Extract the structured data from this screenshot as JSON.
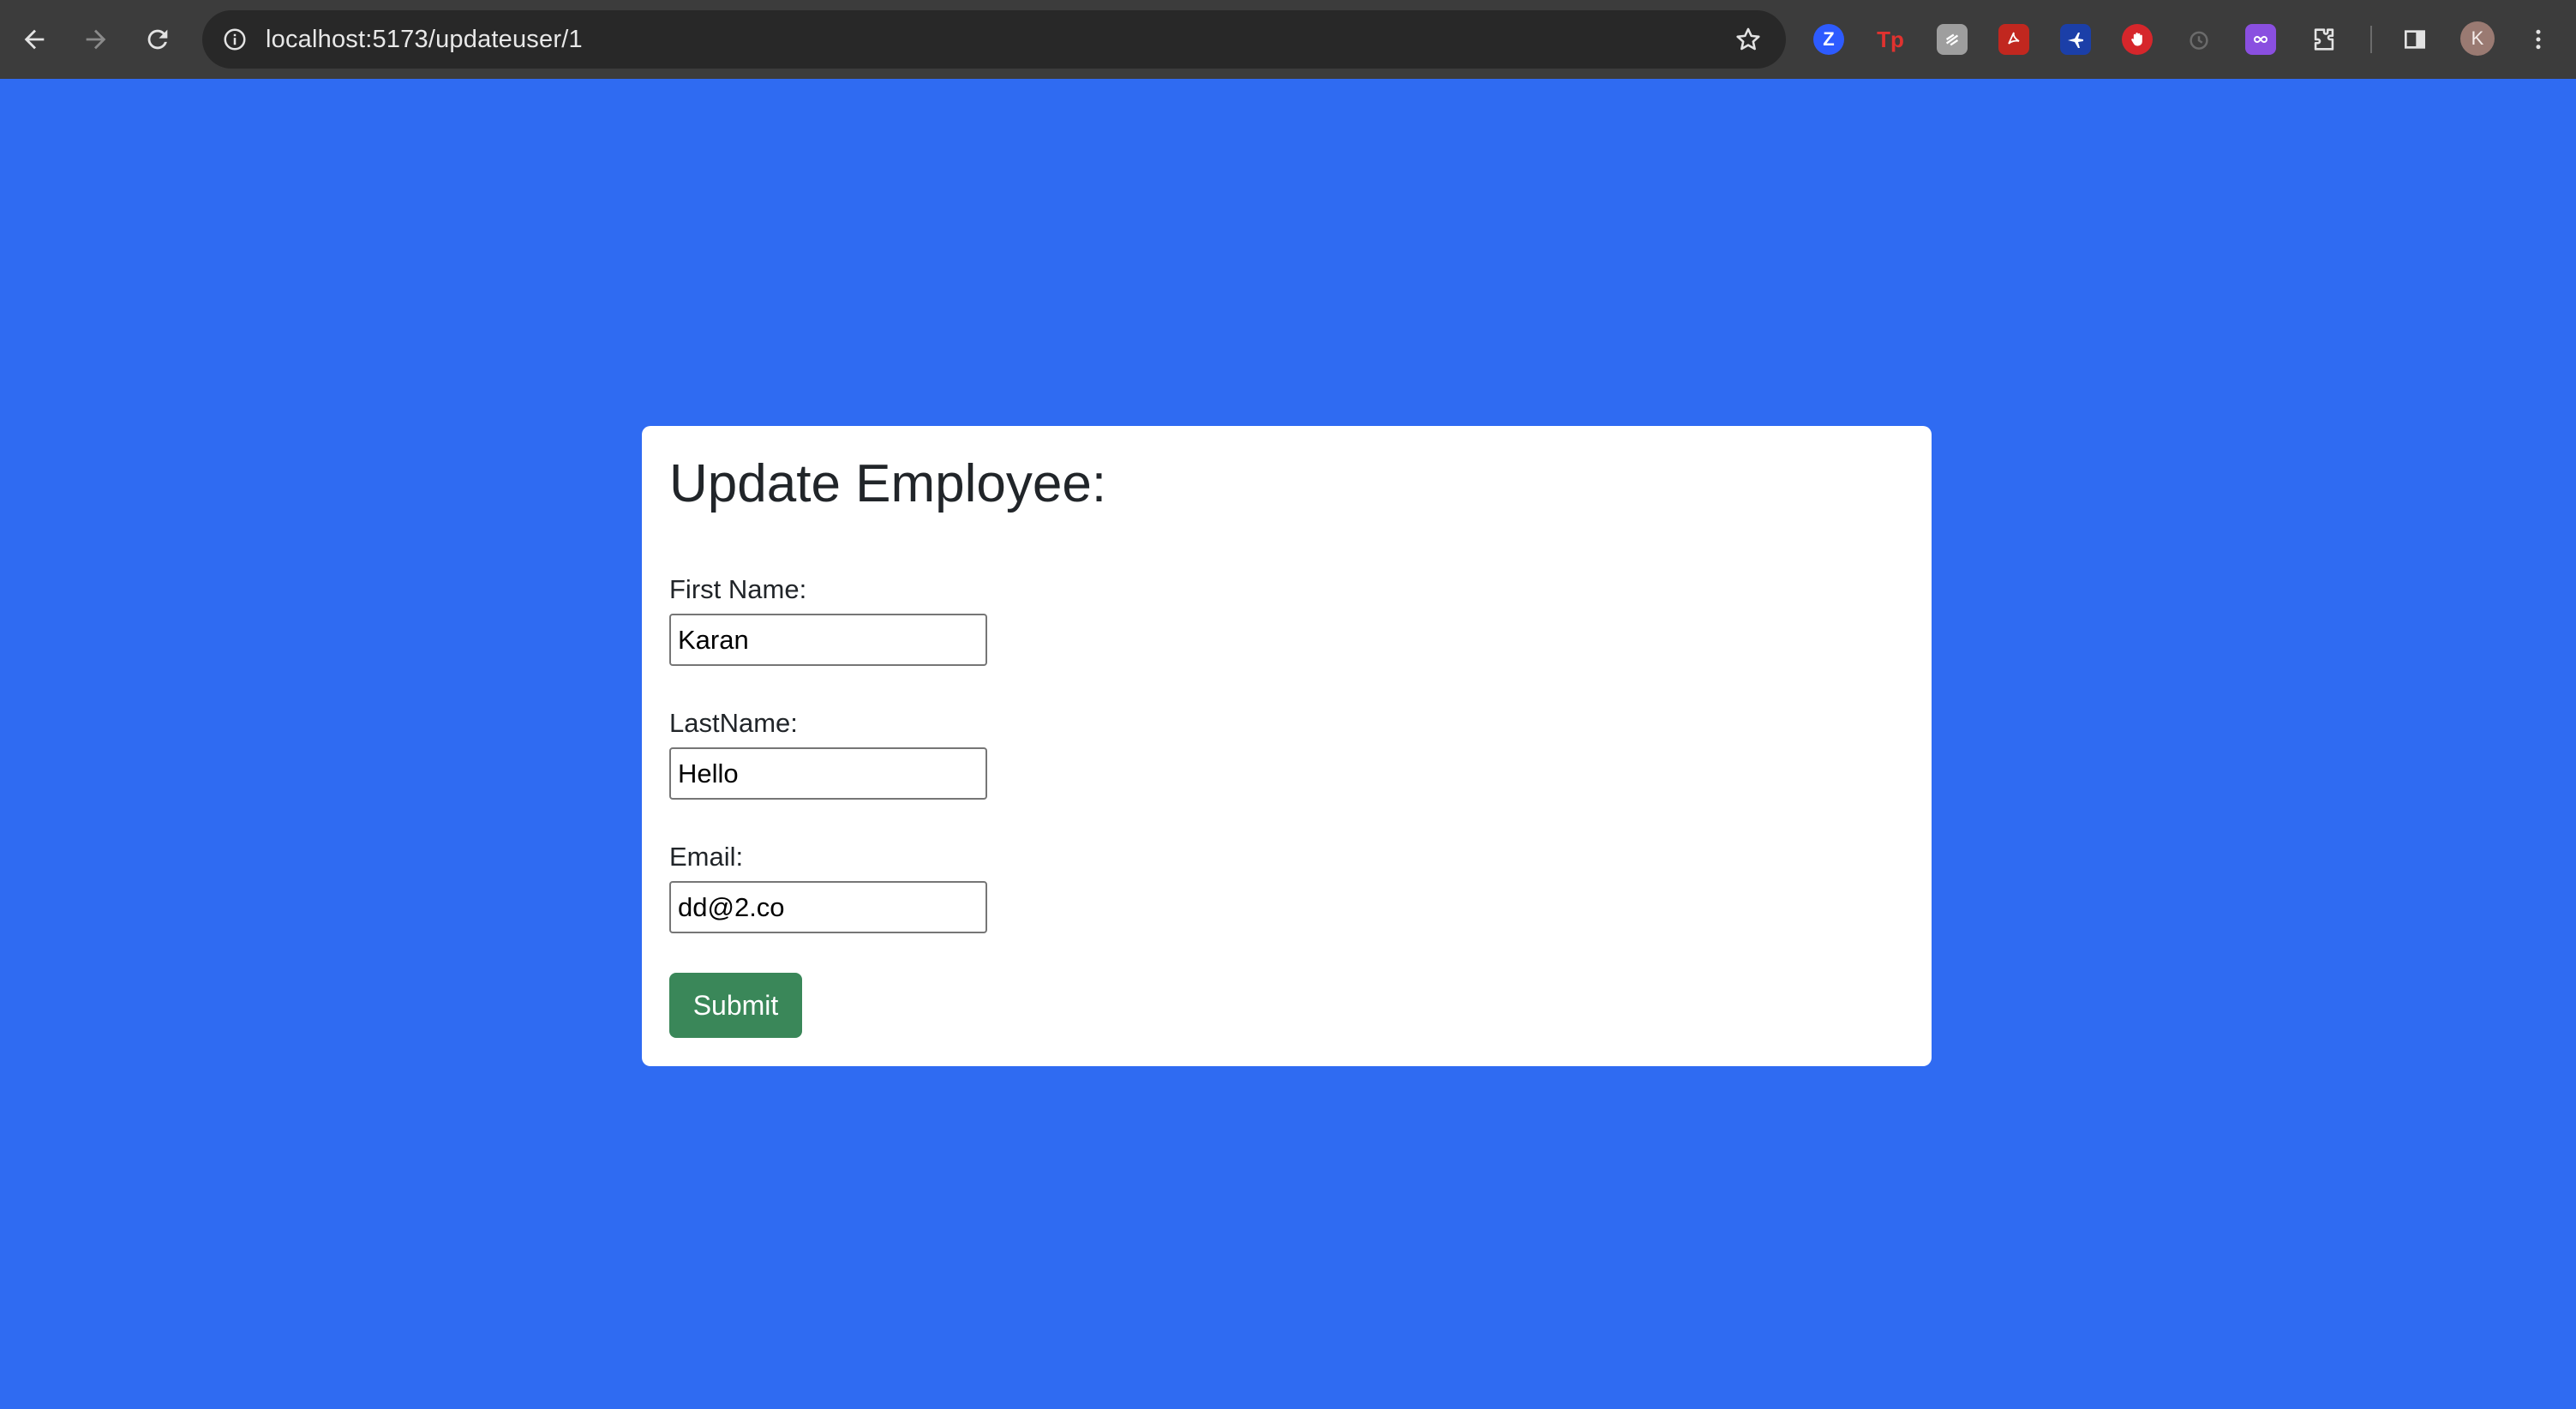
{
  "browser": {
    "url": "localhost:5173/updateuser/1",
    "profile_initial": "K",
    "extensions": [
      {
        "icon": "zoom-z-icon",
        "glyph": "Z",
        "color": "#2d5bff"
      },
      {
        "icon": "tp-icon",
        "glyph": "Tp",
        "color": "#e0322f"
      },
      {
        "icon": "notes-icon",
        "glyph": "",
        "color": "#9e9e9e"
      },
      {
        "icon": "pdf-icon",
        "glyph": "",
        "color": "#c1271f"
      },
      {
        "icon": "plane-icon",
        "glyph": "",
        "color": "#1b3fa8"
      },
      {
        "icon": "stop-hand-icon",
        "glyph": "",
        "color": "#d6262b"
      },
      {
        "icon": "timer-icon",
        "glyph": "",
        "color": "#6b6b6b"
      },
      {
        "icon": "link-icon",
        "glyph": "",
        "color": "#8a4fe0"
      }
    ]
  },
  "form": {
    "title": "Update Employee:",
    "first_name_label": "First Name:",
    "first_name_value": "Karan",
    "last_name_label": "LastName:",
    "last_name_value": "Hello",
    "email_label": "Email:",
    "email_value": "dd@2.co",
    "submit_label": "Submit"
  },
  "colors": {
    "page_background": "#2f6bf2",
    "submit_button": "#3a8759"
  }
}
